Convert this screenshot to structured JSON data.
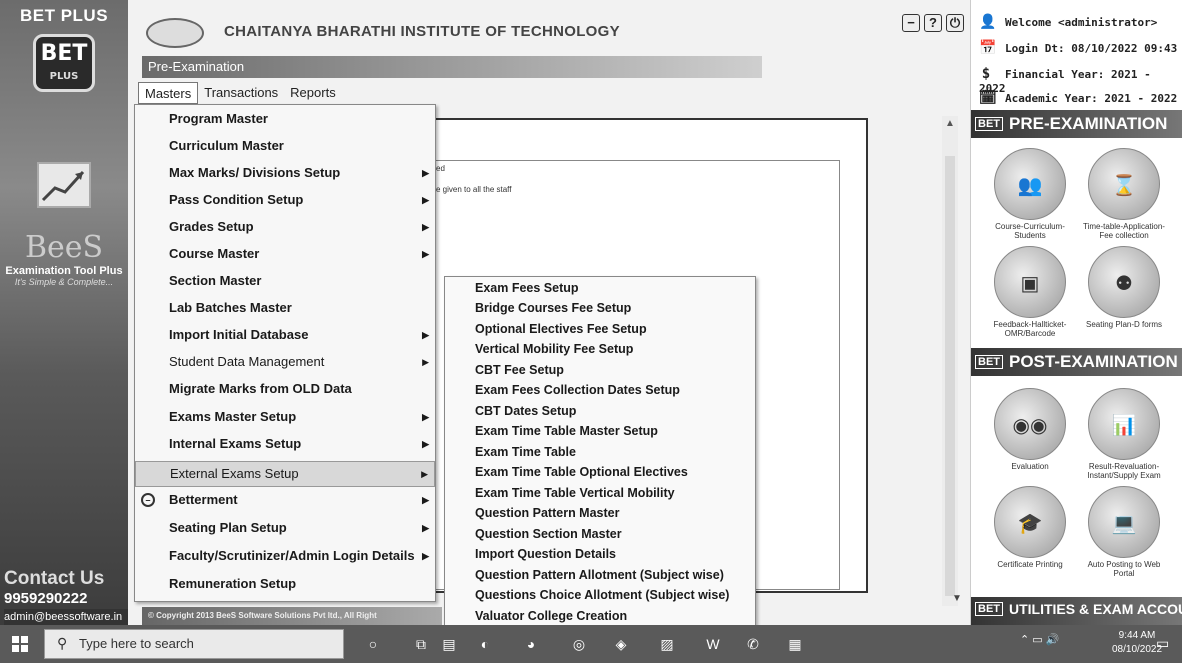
{
  "sidebar": {
    "brand": "BET PLUS",
    "bet_logo": "BET",
    "bet_logo_sub": "PLUS",
    "bees_logo": "BeeS",
    "tagline": "Examination Tool Plus",
    "slogan": "It's Simple & Complete...",
    "contact_title": "Contact Us",
    "phone": "9959290222",
    "email": "admin@beessoftware.in"
  },
  "header": {
    "institute": "CHAITANYA BHARATHI INSTITUTE OF TECHNOLOGY",
    "module": "Pre-Examination",
    "window_controls": [
      "minimize-icon",
      "help-icon",
      "power-icon"
    ]
  },
  "menubar": {
    "items": [
      "Masters",
      "Transactions",
      "Reports"
    ]
  },
  "masters_menu": [
    {
      "label": "Program Master",
      "submenu": false,
      "style": "bold"
    },
    {
      "label": "Curriculum Master",
      "submenu": false,
      "style": "bold"
    },
    {
      "label": "Max Marks/ Divisions Setup",
      "submenu": true,
      "style": "bold"
    },
    {
      "label": "Pass Condition Setup",
      "submenu": true,
      "style": "bold"
    },
    {
      "label": "Grades Setup",
      "submenu": true,
      "style": "bold"
    },
    {
      "label": "Course Master",
      "submenu": true,
      "style": "bold"
    },
    {
      "label": "Section Master",
      "submenu": false,
      "style": "bold"
    },
    {
      "label": "Lab Batches Master",
      "submenu": false,
      "style": "bold"
    },
    {
      "label": "Import Initial Database",
      "submenu": true,
      "style": "bold"
    },
    {
      "label": "Student Data Management",
      "submenu": true,
      "style": "normal"
    },
    {
      "label": "Migrate Marks from OLD Data",
      "submenu": false,
      "style": "bold"
    },
    {
      "label": "Exams Master Setup",
      "submenu": true,
      "style": "bold"
    },
    {
      "label": "Internal Exams Setup",
      "submenu": true,
      "style": "bold"
    },
    {
      "label": "External Exams Setup",
      "submenu": true,
      "style": "highlight"
    },
    {
      "label": "Betterment",
      "submenu": true,
      "style": "bold",
      "icon": "betterment-icon"
    },
    {
      "label": "Seating Plan Setup",
      "submenu": true,
      "style": "bold"
    },
    {
      "label": "Faculty/Scrutinizer/Admin Login Details",
      "submenu": true,
      "style": "bold"
    },
    {
      "label": "Remuneration Setup",
      "submenu": false,
      "style": "bold"
    }
  ],
  "external_exams_submenu": [
    "Exam Fees Setup",
    "Bridge Courses Fee Setup",
    "Optional Electives Fee Setup",
    "Vertical Mobility Fee Setup",
    "CBT Fee Setup",
    "Exam Fees Collection Dates Setup",
    "CBT Dates Setup",
    "Exam Time Table Master Setup",
    "Exam Time Table",
    "Exam Time Table Optional Electives",
    "Exam Time Table Vertical Mobility",
    "Question Pattern Master",
    "Question Section Master",
    "Import Question Details",
    "Question Pattern Allotment (Subject wise)",
    "Questions Choice Allotment (Subject wise)",
    "Valuator College Creation"
  ],
  "content": {
    "line1": "ed",
    "line2": "e given to all the staff"
  },
  "right_panel": {
    "welcome": "Welcome <administrator>",
    "login": "Login Dt: 08/10/2022 09:43",
    "financial_year": "Financial Year: 2021 - 2022",
    "academic_year": "Academic Year: 2021 - 2022",
    "pre_exam_header": "PRE-EXAMINATION",
    "post_exam_header": "POST-EXAMINATION",
    "utilities_header": "UTILITIES & EXAM ACCOUNT",
    "bet_tag": "BET",
    "pre_modules": [
      {
        "label": "Course-Curriculum-Students",
        "icon": "students-icon"
      },
      {
        "label": "Time-table-Application-Fee collection",
        "icon": "hourglass-icon"
      },
      {
        "label": "Feedback-Hallticket-OMR/Barcode",
        "icon": "omr-scanner-icon"
      },
      {
        "label": "Seating Plan-D forms",
        "icon": "seating-icon"
      }
    ],
    "post_modules": [
      {
        "label": "Evaluation",
        "icon": "evaluation-icon"
      },
      {
        "label": "Result-Revaluation-Instant/Supply Exam",
        "icon": "result-icon"
      },
      {
        "label": "Certificate Printing",
        "icon": "certificate-icon"
      },
      {
        "label": "Auto Posting to Web Portal",
        "icon": "laptop-icon"
      }
    ]
  },
  "copyright": "© Copyright 2013 BeeS Software Solutions Pvt ltd., All Right",
  "taskbar": {
    "search_placeholder": "Type here to search",
    "time": "9:44 AM",
    "date": "08/10/2022"
  }
}
